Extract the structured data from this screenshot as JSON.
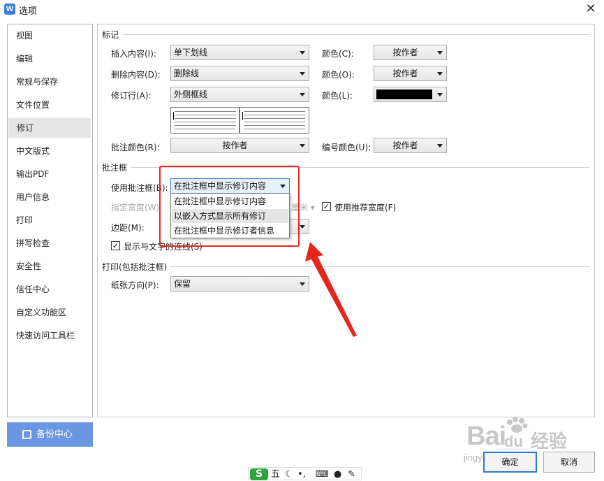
{
  "window": {
    "title": "选项",
    "logo_letter": "W",
    "close_glyph": "✕"
  },
  "sidebar": {
    "items": [
      {
        "label": "视图"
      },
      {
        "label": "编辑"
      },
      {
        "label": "常规与保存"
      },
      {
        "label": "文件位置"
      },
      {
        "label": "修订",
        "active": true
      },
      {
        "label": "中文版式"
      },
      {
        "label": "输出PDF"
      },
      {
        "label": "用户信息"
      },
      {
        "label": "打印"
      },
      {
        "label": "拼写检查"
      },
      {
        "label": "安全性"
      },
      {
        "label": "信任中心"
      },
      {
        "label": "自定义功能区"
      },
      {
        "label": "快速访问工具栏"
      }
    ],
    "backup_button": "备份中心"
  },
  "markup": {
    "section": "标记",
    "insert_label": "插入内容(I):",
    "insert_value": "单下划线",
    "insert_color_label": "颜色(C):",
    "insert_color_value": "按作者",
    "delete_label": "删除内容(D):",
    "delete_value": "删除线",
    "delete_color_label": "颜色(O):",
    "delete_color_value": "按作者",
    "revline_label": "修订行(A):",
    "revline_value": "外侧框线",
    "revline_color_label": "颜色(L):",
    "revline_color": "#000000",
    "comment_color_label": "批注颜色(R):",
    "comment_color_value": "按作者",
    "number_color_label": "编号颜色(U):",
    "number_color_value": "按作者"
  },
  "balloons": {
    "section": "批注框",
    "use_label": "使用批注框(B):",
    "use_value": "在批注框中显示修订内容",
    "dropdown_options": [
      "在批注框中显示修订内容",
      "以嵌入方式显示所有修订",
      "在批注框中显示修订者信息"
    ],
    "width_label": "指定宽度(W)",
    "width_unit": "厘米",
    "recommended_width_label": "使用推荐宽度(F)",
    "recommended_width_checked": "✓",
    "margin_label": "边距(M):",
    "show_lines_label": "显示与文字的连线(S)",
    "show_lines_checked": "✓"
  },
  "printing": {
    "section": "打印(包括批注框)",
    "paper_label": "纸张方向(P):",
    "paper_value": "保留"
  },
  "buttons": {
    "ok": "确定",
    "cancel": "取消"
  },
  "watermark": {
    "brand": "Bai",
    "paw": "du",
    "cn": "经验",
    "url": "jingyan.baidu.com"
  },
  "ime": {
    "logo": "S",
    "mode": "五"
  },
  "colors": {
    "accent": "#6b97e2",
    "annotation_red": "#e5261f",
    "focus_blue": "#2f77d8"
  }
}
